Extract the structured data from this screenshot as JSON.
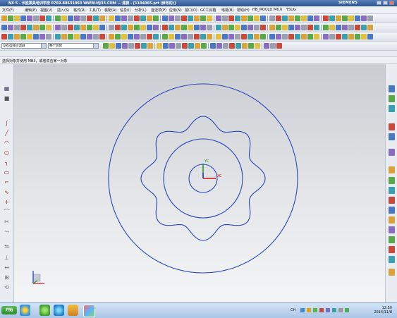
{
  "window": {
    "title": "NX 5 - 长胜模具培训学校    0769-88631050    WWW.MJ33.COM — 建模 - [1104065.prt (修改的)]",
    "brand": "SIEMENS"
  },
  "menu": {
    "items": [
      "文件(F)",
      "编辑(E)",
      "视图(V)",
      "插入(S)",
      "格式(R)",
      "工具(T)",
      "装配(A)",
      "信息(I)",
      "分析(L)",
      "首选项(P)",
      "应用(N)",
      "窗口(O)",
      "GC工具箱",
      "电极(B)",
      "帮助(H)",
      "HB_MOULD",
      "M6.6",
      "YSUG"
    ]
  },
  "filter": {
    "selection_filter": "没有选择过滤器",
    "scope": "整个装配"
  },
  "prompt": {
    "text": "选择对象并使用 MB3，或者双击某一对象"
  },
  "canvas": {
    "wcs_label": "XC",
    "wcs_label_y": "YC"
  },
  "taskbar": {
    "start": "开始",
    "clock_time": "12:50",
    "clock_date": "2014/11/8",
    "ime": "CH"
  },
  "colors": {
    "curve": "#2a44b8",
    "wcs_x": "#d01010",
    "wcs_y": "#1a8a1a",
    "wcs_z": "#1533c8"
  }
}
